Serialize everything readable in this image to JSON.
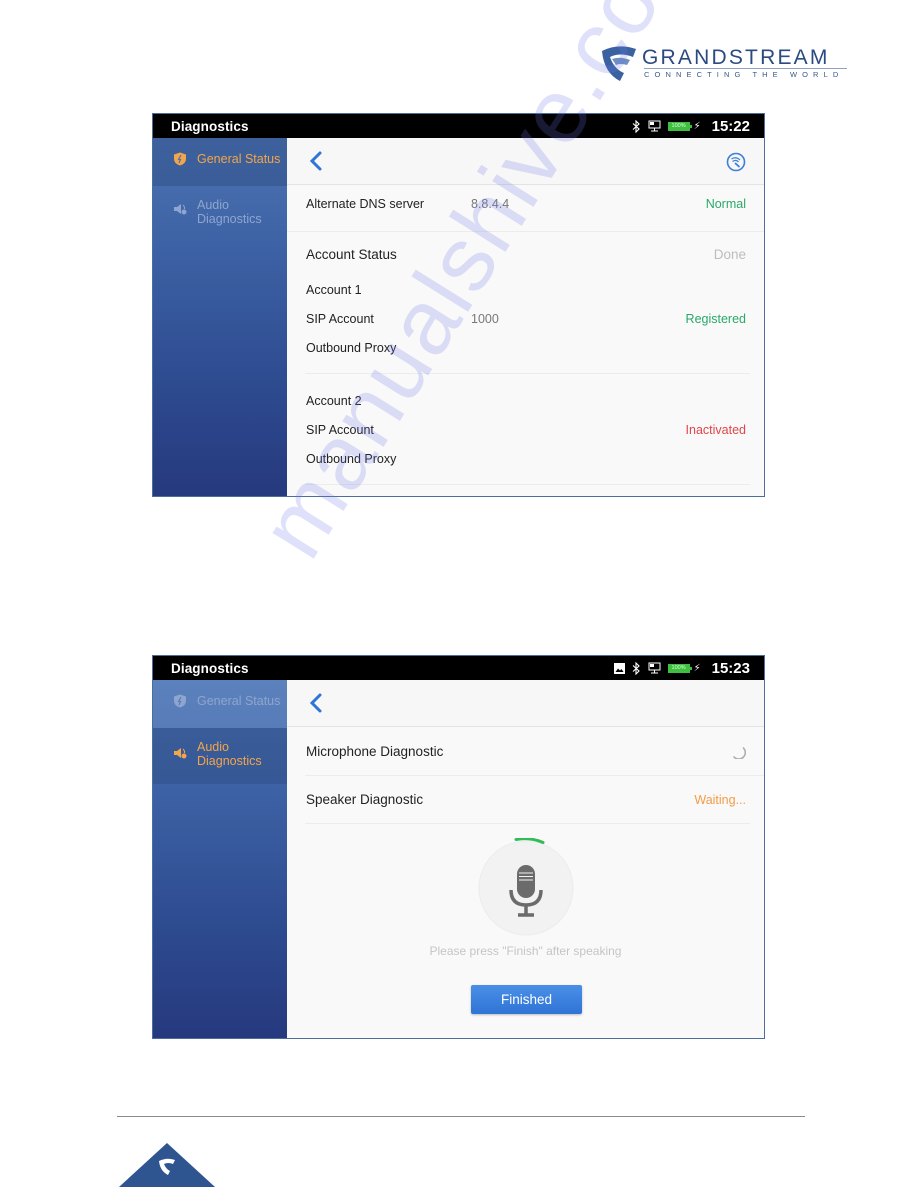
{
  "brand": {
    "name": "GRANDSTREAM",
    "tagline": "CONNECTING THE WORLD",
    "color": "#2b4a80"
  },
  "screens": [
    {
      "status_bar": {
        "title": "Diagnostics",
        "icons": [
          "bluetooth-icon",
          "network-icon",
          "battery-icon",
          "charging-icon"
        ],
        "battery": "100%",
        "time": "15:22"
      },
      "sidebar": {
        "items": [
          {
            "label": "General Status",
            "icon": "shield-icon",
            "active": true
          },
          {
            "label_line1": "Audio",
            "label_line2": "Diagnostics",
            "icon": "speaker-icon",
            "active": false
          }
        ]
      },
      "toolbar": {
        "back_icon": "chevron-left-icon",
        "action_icon": "diagnose-icon"
      },
      "dns_row": {
        "label": "Alternate DNS server",
        "value": "8.8.4.4",
        "status": "Normal"
      },
      "account_status": {
        "title": "Account Status",
        "state": "Done",
        "accounts": [
          {
            "name": "Account 1",
            "sip_label": "SIP Account",
            "sip_value": "1000",
            "sip_status": "Registered",
            "proxy_label": "Outbound Proxy"
          },
          {
            "name": "Account 2",
            "sip_label": "SIP Account",
            "sip_value": "",
            "sip_status": "Inactivated",
            "proxy_label": "Outbound Proxy"
          }
        ]
      }
    },
    {
      "status_bar": {
        "title": "Diagnostics",
        "icons": [
          "image-icon",
          "bluetooth-icon",
          "network-icon",
          "battery-icon",
          "charging-icon"
        ],
        "battery": "100%",
        "time": "15:23"
      },
      "sidebar": {
        "items": [
          {
            "label": "General Status",
            "icon": "shield-icon",
            "active": false
          },
          {
            "label_line1": "Audio",
            "label_line2": "Diagnostics",
            "icon": "speaker-icon",
            "active": true
          }
        ]
      },
      "toolbar": {
        "back_icon": "chevron-left-icon"
      },
      "tests": [
        {
          "label": "Microphone Diagnostic",
          "status": "loading-spinner"
        },
        {
          "label": "Speaker Diagnostic",
          "status": "Waiting..."
        }
      ],
      "mic_panel": {
        "icon": "microphone-icon",
        "hint": "Please press \"Finish\" after speaking",
        "button_label": "Finished"
      }
    }
  ],
  "colors": {
    "accent_orange": "#f3a54a",
    "status_green": "#2aa86a",
    "status_red": "#e0454a",
    "button_blue": "#2f74d6",
    "sidebar_blue": "#3d62a5"
  },
  "watermark": "manualshive.com"
}
